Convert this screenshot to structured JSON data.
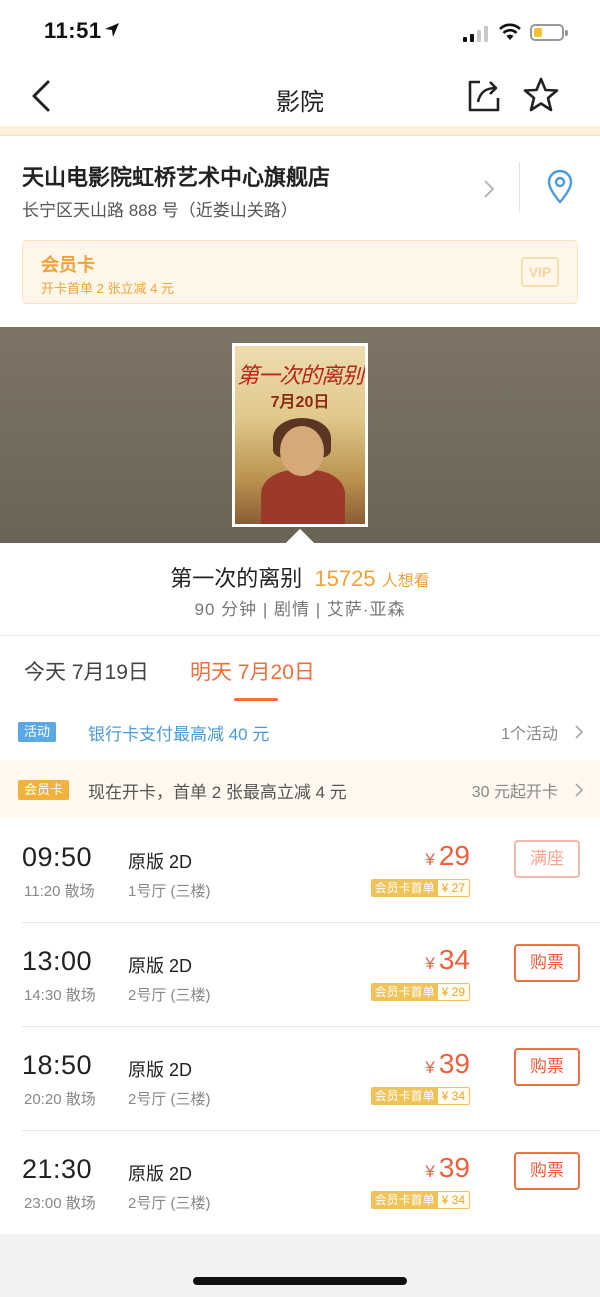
{
  "status_bar": {
    "time": "11:51"
  },
  "nav": {
    "title": "影院"
  },
  "cinema": {
    "name": "天山电影院虹桥艺术中心旗舰店",
    "address": "长宁区天山路 888 号（近娄山关路）"
  },
  "vip_card": {
    "title": "会员卡",
    "subtitle": "开卡首单 2 张立减 4 元",
    "badge": "VIP"
  },
  "poster": {
    "title": "第一次的离别",
    "date": "7月20日"
  },
  "movie": {
    "title": "第一次的离别",
    "want_count": "15725",
    "want_label": "人想看",
    "meta": "90 分钟 | 剧情 | 艾萨·亚森"
  },
  "date_tabs": [
    {
      "label": "今天 7月19日",
      "active": false
    },
    {
      "label": "明天 7月20日",
      "active": true
    }
  ],
  "promos": {
    "activity": {
      "tag": "活动",
      "text": "银行卡支付最高减 40 元",
      "right": "1个活动"
    },
    "member": {
      "tag": "会员卡",
      "text": "现在开卡，首单 2 张最高立减 4 元",
      "right": "30 元起开卡"
    }
  },
  "showtimes": [
    {
      "time": "09:50",
      "end": "11:20 散场",
      "version": "原版 2D",
      "hall": "1号厅 (三楼)",
      "currency": "¥",
      "price": "29",
      "card_label": "会员卡首单",
      "card_price": "¥ 27",
      "button": "满座",
      "sold_out": true
    },
    {
      "time": "13:00",
      "end": "14:30 散场",
      "version": "原版 2D",
      "hall": "2号厅 (三楼)",
      "currency": "¥",
      "price": "34",
      "card_label": "会员卡首单",
      "card_price": "¥ 29",
      "button": "购票",
      "sold_out": false
    },
    {
      "time": "18:50",
      "end": "20:20 散场",
      "version": "原版 2D",
      "hall": "2号厅 (三楼)",
      "currency": "¥",
      "price": "39",
      "card_label": "会员卡首单",
      "card_price": "¥ 34",
      "button": "购票",
      "sold_out": false
    },
    {
      "time": "21:30",
      "end": "23:00 散场",
      "version": "原版 2D",
      "hall": "2号厅 (三楼)",
      "currency": "¥",
      "price": "39",
      "card_label": "会员卡首单",
      "card_price": "¥ 34",
      "button": "购票",
      "sold_out": false
    }
  ],
  "colors": {
    "accent": "#ef6f3d",
    "price": "#ef5f3b",
    "gold": "#f0a23a",
    "activity_tag": "#5aa9e6",
    "activity_text": "#4a9ad8",
    "member_tag": "#f0b23a"
  }
}
